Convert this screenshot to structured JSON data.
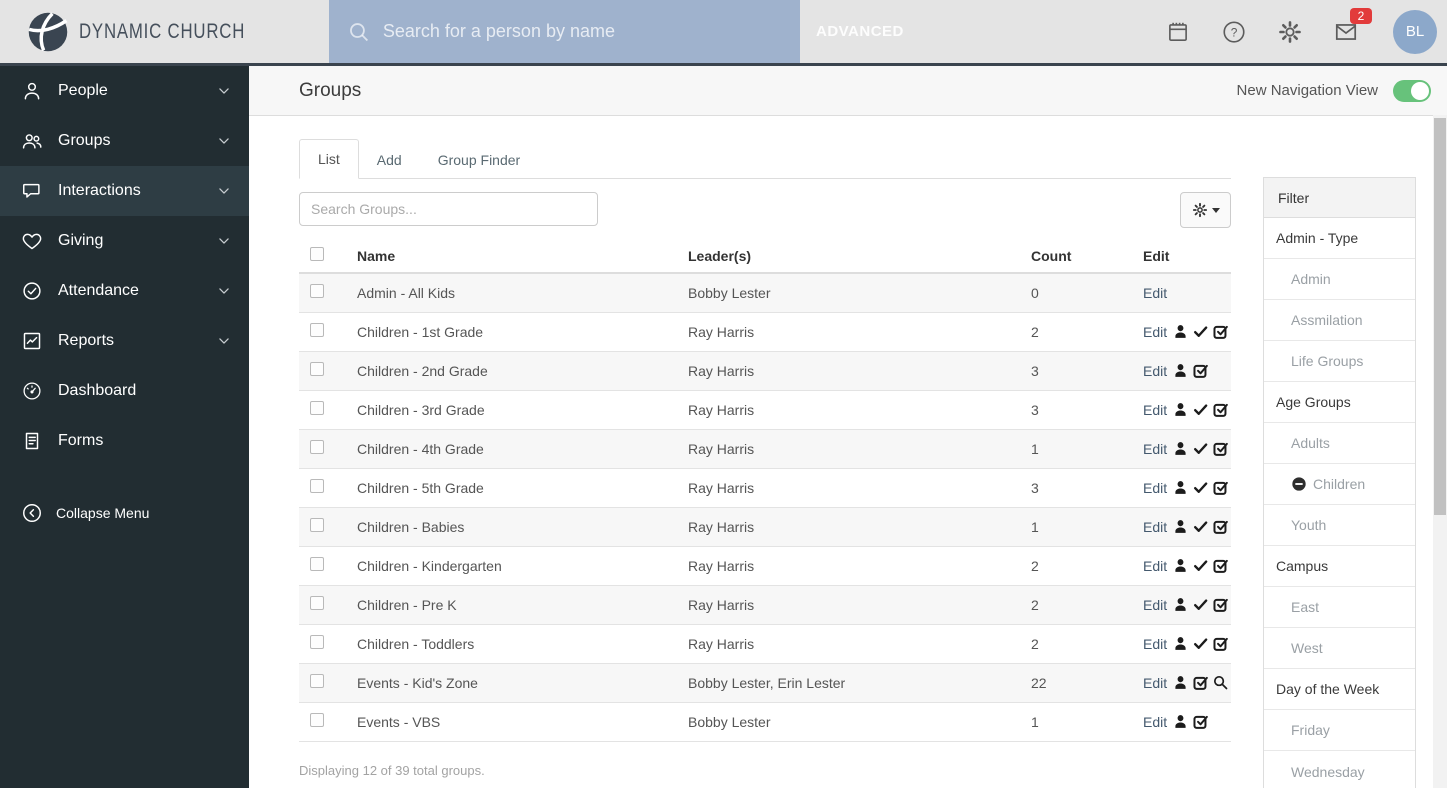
{
  "header": {
    "brand": "DYNAMIC CHURCH",
    "search_placeholder": "Search for a person by name",
    "advanced_label": "ADVANCED",
    "mail_badge": "2",
    "avatar_initials": "BL"
  },
  "sidebar": {
    "items": [
      {
        "label": "People",
        "icon": "person-outline",
        "expandable": true,
        "active": false
      },
      {
        "label": "Groups",
        "icon": "people",
        "expandable": true,
        "active": false
      },
      {
        "label": "Interactions",
        "icon": "chat",
        "expandable": true,
        "active": true
      },
      {
        "label": "Giving",
        "icon": "heart",
        "expandable": true,
        "active": false
      },
      {
        "label": "Attendance",
        "icon": "check-circle",
        "expandable": true,
        "active": false
      },
      {
        "label": "Reports",
        "icon": "chart",
        "expandable": true,
        "active": false
      },
      {
        "label": "Dashboard",
        "icon": "gauge",
        "expandable": false,
        "active": false
      },
      {
        "label": "Forms",
        "icon": "form",
        "expandable": false,
        "active": false
      }
    ],
    "collapse_label": "Collapse Menu"
  },
  "page": {
    "title": "Groups",
    "toggle_label": "New Navigation View",
    "toggle_on": true,
    "toggle_color": "#67c27b"
  },
  "tabs": [
    {
      "label": "List",
      "active": true
    },
    {
      "label": "Add",
      "active": false
    },
    {
      "label": "Group Finder",
      "active": false
    }
  ],
  "toolbar": {
    "search_placeholder": "Search Groups..."
  },
  "table": {
    "columns": [
      "Name",
      "Leader(s)",
      "Count",
      "Edit"
    ],
    "edit_label": "Edit",
    "rows": [
      {
        "name": "Admin - All Kids",
        "leaders": "Bobby Lester",
        "count": "0",
        "icons": []
      },
      {
        "name": "Children - 1st Grade",
        "leaders": "Ray Harris",
        "count": "2",
        "icons": [
          "person",
          "check",
          "check-square"
        ]
      },
      {
        "name": "Children - 2nd Grade",
        "leaders": "Ray Harris",
        "count": "3",
        "icons": [
          "person",
          "check-square"
        ]
      },
      {
        "name": "Children - 3rd Grade",
        "leaders": "Ray Harris",
        "count": "3",
        "icons": [
          "person",
          "check",
          "check-square"
        ]
      },
      {
        "name": "Children - 4th Grade",
        "leaders": "Ray Harris",
        "count": "1",
        "icons": [
          "person",
          "check",
          "check-square"
        ]
      },
      {
        "name": "Children - 5th Grade",
        "leaders": "Ray Harris",
        "count": "3",
        "icons": [
          "person",
          "check",
          "check-square"
        ]
      },
      {
        "name": "Children - Babies",
        "leaders": "Ray Harris",
        "count": "1",
        "icons": [
          "person",
          "check",
          "check-square"
        ]
      },
      {
        "name": "Children - Kindergarten",
        "leaders": "Ray Harris",
        "count": "2",
        "icons": [
          "person",
          "check",
          "check-square"
        ]
      },
      {
        "name": "Children - Pre K",
        "leaders": "Ray Harris",
        "count": "2",
        "icons": [
          "person",
          "check",
          "check-square"
        ]
      },
      {
        "name": "Children - Toddlers",
        "leaders": "Ray Harris",
        "count": "2",
        "icons": [
          "person",
          "check",
          "check-square"
        ]
      },
      {
        "name": "Events - Kid's Zone",
        "leaders": "Bobby Lester, Erin Lester",
        "count": "22",
        "icons": [
          "person",
          "check-square",
          "magnifier"
        ]
      },
      {
        "name": "Events - VBS",
        "leaders": "Bobby Lester",
        "count": "1",
        "icons": [
          "person",
          "check-square"
        ]
      }
    ],
    "footer": "Displaying 12 of 39 total groups."
  },
  "filter": {
    "title": "Filter",
    "items": [
      {
        "label": "Admin - Type",
        "level": 0
      },
      {
        "label": "Admin",
        "level": 1
      },
      {
        "label": "Assmilation",
        "level": 1
      },
      {
        "label": "Life Groups",
        "level": 1
      },
      {
        "label": "Age Groups",
        "level": 0
      },
      {
        "label": "Adults",
        "level": 1
      },
      {
        "label": "Children",
        "level": 1,
        "icon": "minus-circle"
      },
      {
        "label": "Youth",
        "level": 1
      },
      {
        "label": "Campus",
        "level": 0
      },
      {
        "label": "East",
        "level": 1
      },
      {
        "label": "West",
        "level": 1
      },
      {
        "label": "Day of the Week",
        "level": 0
      },
      {
        "label": "Friday",
        "level": 1
      },
      {
        "label": "Wednesday",
        "level": 1
      }
    ]
  }
}
